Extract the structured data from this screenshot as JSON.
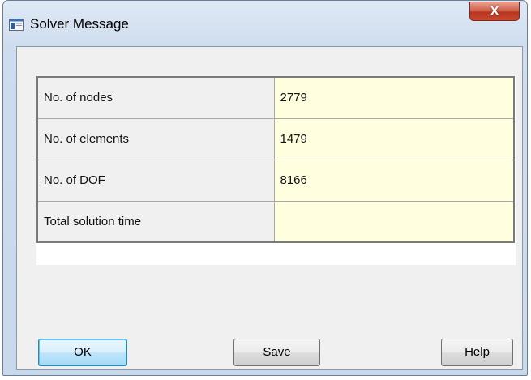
{
  "window": {
    "title": "Solver Message",
    "close_label": "X"
  },
  "table": {
    "rows": [
      {
        "label": "No. of nodes",
        "value": "2779"
      },
      {
        "label": "No. of elements",
        "value": "1479"
      },
      {
        "label": "No. of DOF",
        "value": "8166"
      },
      {
        "label": "Total solution time",
        "value": ""
      }
    ]
  },
  "buttons": {
    "ok": "OK",
    "save": "Save",
    "help": "Help"
  },
  "icons": {
    "app": "window-app-icon",
    "close": "close-icon"
  },
  "colors": {
    "value_cell_bg": "#ffffe0",
    "label_cell_bg": "#f0f0f0",
    "close_button": "#c9482c"
  }
}
